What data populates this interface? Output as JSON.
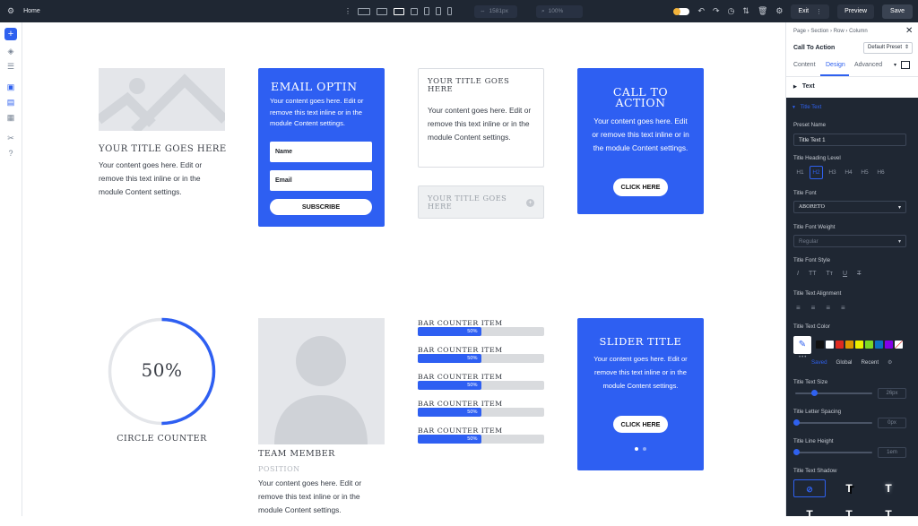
{
  "topbar": {
    "home": "Home",
    "width_value": "1581px",
    "zoom_value": "100%",
    "exit_label": "Exit",
    "preview_label": "Preview",
    "save_label": "Save"
  },
  "modules": {
    "image_blurb": {
      "title": "YOUR TITLE GOES HERE",
      "body": "Your content goes here. Edit or remove this text inline or in the module Content settings."
    },
    "email_optin": {
      "title": "EMAIL OPTIN",
      "body": "Your content goes here. Edit or remove this text inline or in the module Content settings.",
      "name_placeholder": "Name",
      "email_placeholder": "Email",
      "button": "SUBSCRIBE"
    },
    "text_box": {
      "title": "YOUR TITLE GOES HERE",
      "body": "Your content goes here. Edit or remove this text inline or in the module Content settings."
    },
    "toggle": {
      "title": "YOUR TITLE GOES HERE"
    },
    "cta": {
      "title": "CALL TO ACTION",
      "body": "Your content goes here. Edit or remove this text inline or in the module Content settings.",
      "button": "CLICK HERE"
    },
    "circle_counter": {
      "value_text": "50%",
      "percent": 50,
      "label": "CIRCLE COUNTER"
    },
    "team_member": {
      "name": "TEAM MEMBER",
      "position": "POSITION",
      "body": "Your content goes here. Edit or remove this text inline or in the module Content settings."
    },
    "bar_counters": [
      {
        "label": "BAR COUNTER ITEM",
        "value_text": "50%",
        "percent": 50
      },
      {
        "label": "BAR COUNTER ITEM",
        "value_text": "50%",
        "percent": 50
      },
      {
        "label": "BAR COUNTER ITEM",
        "value_text": "50%",
        "percent": 50
      },
      {
        "label": "BAR COUNTER ITEM",
        "value_text": "50%",
        "percent": 50
      },
      {
        "label": "BAR COUNTER ITEM",
        "value_text": "50%",
        "percent": 50
      }
    ],
    "slider": {
      "title": "SLIDER TITLE",
      "body": "Your content goes here. Edit or remove this text inline or in the module Content settings.",
      "button": "CLICK HERE"
    }
  },
  "panel": {
    "breadcrumb": [
      "Page",
      "Section",
      "Row",
      "Column"
    ],
    "module_name": "Call To Action",
    "preset": "Default Preset",
    "tabs": [
      "Content",
      "Design",
      "Advanced"
    ],
    "active_tab": "Design",
    "text_group": "Text",
    "title_text_group": "Title Text",
    "preset_name_label": "Preset Name",
    "preset_name_value": "Title Text 1",
    "heading_level_label": "Title Heading Level",
    "heading_levels": [
      "H1",
      "H2",
      "H3",
      "H4",
      "H5",
      "H6"
    ],
    "active_heading": "H2",
    "title_font_label": "Title Font",
    "title_font_value": "ABORETO",
    "font_weight_label": "Title Font Weight",
    "font_weight_value": "Regular",
    "font_style_label": "Title Font Style",
    "font_style_glyphs": [
      "I",
      "TT",
      "Tт",
      "U",
      "T"
    ],
    "alignment_label": "Title Text Alignment",
    "color_label": "Title Text Color",
    "swatches": [
      "#111111",
      "#ffffff",
      "#e02b20",
      "#e09900",
      "#edf000",
      "#7cda24",
      "#0c71c3",
      "#8300e9"
    ],
    "color_tabs": [
      "Saved",
      "Global",
      "Recent"
    ],
    "size_label": "Title Text Size",
    "size_value": "26px",
    "letter_spacing_label": "Title Letter Spacing",
    "letter_spacing_value": "0px",
    "line_height_label": "Title Line Height",
    "line_height_value": "1em",
    "shadow_label": "Title Text Shadow"
  }
}
